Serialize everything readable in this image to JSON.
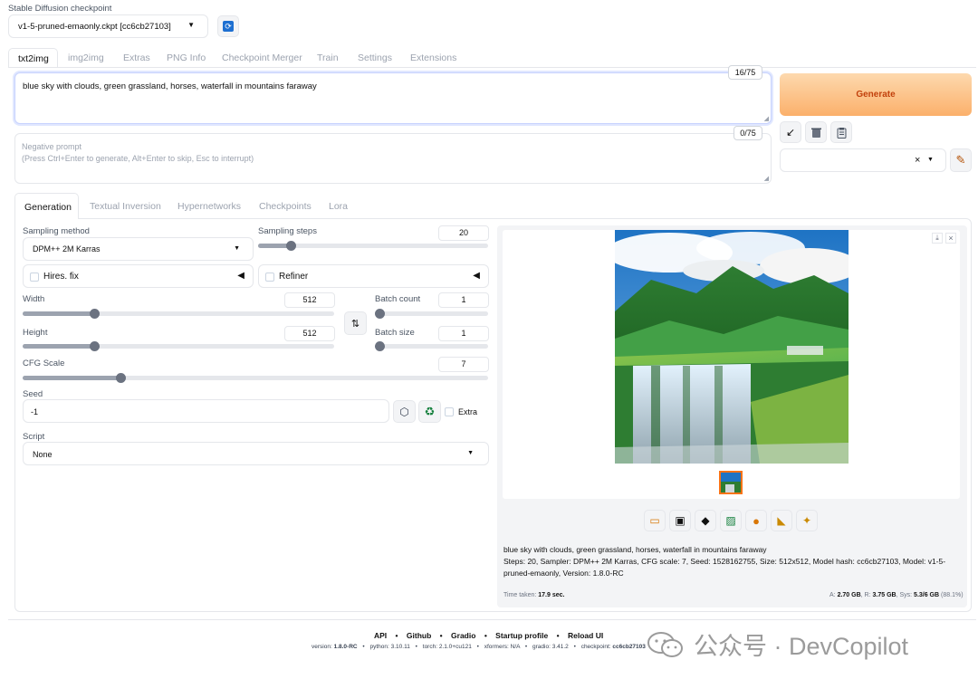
{
  "checkpoint": {
    "label": "Stable Diffusion checkpoint",
    "value": "v1-5-pruned-emaonly.ckpt [cc6cb27103]"
  },
  "main_tabs": [
    "txt2img",
    "img2img",
    "Extras",
    "PNG Info",
    "Checkpoint Merger",
    "Train",
    "Settings",
    "Extensions"
  ],
  "prompt": {
    "value": "blue sky with clouds, green grassland, horses, waterfall in mountains faraway",
    "token_count": "16/75"
  },
  "negative_prompt": {
    "placeholder": "Negative prompt\n(Press Ctrl+Enter to generate, Alt+Enter to skip, Esc to interrupt)",
    "token_count": "0/75"
  },
  "generate_label": "Generate",
  "style_clear": "×",
  "sub_tabs": [
    "Generation",
    "Textual Inversion",
    "Hypernetworks",
    "Checkpoints",
    "Lora"
  ],
  "sampling_method": {
    "label": "Sampling method",
    "value": "DPM++ 2M Karras"
  },
  "sampling_steps": {
    "label": "Sampling steps",
    "value": "20",
    "fraction": 0.14
  },
  "hires_fix": {
    "label": "Hires. fix",
    "arrow": "◀"
  },
  "refiner": {
    "label": "Refiner",
    "arrow": "◀"
  },
  "width": {
    "label": "Width",
    "value": "512",
    "fraction": 0.23
  },
  "height": {
    "label": "Height",
    "value": "512",
    "fraction": 0.23
  },
  "batch_count": {
    "label": "Batch count",
    "value": "1",
    "fraction": 0.0
  },
  "batch_size": {
    "label": "Batch size",
    "value": "1",
    "fraction": 0.0
  },
  "cfg_scale": {
    "label": "CFG Scale",
    "value": "7",
    "fraction": 0.21
  },
  "seed": {
    "label": "Seed",
    "value": "-1",
    "extra_label": "Extra"
  },
  "script": {
    "label": "Script",
    "value": "None"
  },
  "output": {
    "caption_prompt": "blue sky with clouds, green grassland, horses, waterfall in mountains faraway",
    "caption_params": "Steps: 20, Sampler: DPM++ 2M Karras, CFG scale: 7, Seed: 1528162755, Size: 512x512, Model hash: cc6cb27103, Model: v1-5-pruned-emaonly, Version: 1.8.0-RC",
    "time_label": "Time taken:",
    "time_value": "17.9 sec.",
    "mem_a_label": "A:",
    "mem_a": "2.70 GB",
    "mem_r_label": "R:",
    "mem_r": "3.75 GB",
    "mem_sys_label": "Sys:",
    "mem_sys": "5.3/6 GB",
    "mem_pct": "(88.1%)"
  },
  "footer": {
    "links": [
      "API",
      "Github",
      "Gradio",
      "Startup profile",
      "Reload UI"
    ],
    "version_label": "version:",
    "version": "1.8.0-RC",
    "python_label": "python:",
    "python": "3.10.11",
    "torch_label": "torch:",
    "torch": "2.1.0+cu121",
    "xformers_label": "xformers:",
    "xformers": "N/A",
    "gradio_label": "gradio:",
    "gradio": "3.41.2",
    "checkpoint_label": "checkpoint:",
    "checkpoint": "cc6cb27103"
  },
  "watermark": "公众号 · DevCopilot",
  "colors": {
    "generate_start": "#fdd6a7",
    "generate_end": "#fbb26e",
    "generate_text": "#c2410c"
  }
}
